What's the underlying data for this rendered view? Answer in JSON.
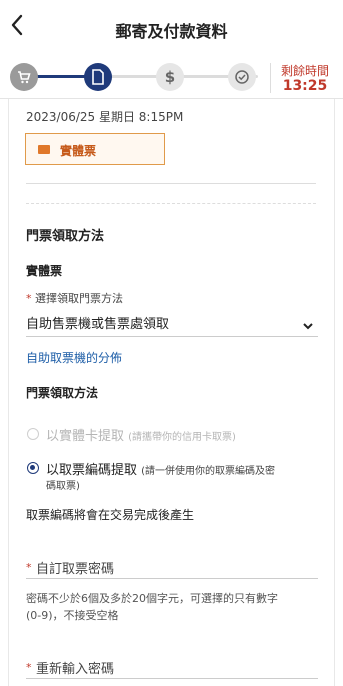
{
  "header": {
    "back_icon": "chevron-left-icon",
    "title": "郵寄及付款資料"
  },
  "steps": {
    "items": [
      {
        "icon": "cart-icon",
        "state": "done"
      },
      {
        "icon": "document-icon",
        "state": "active"
      },
      {
        "icon": "dollar-icon",
        "state": "pending"
      },
      {
        "icon": "check-icon",
        "state": "pending"
      }
    ],
    "colors": {
      "active": "#1f3a7a",
      "pending": "#d9d9d9"
    }
  },
  "timer": {
    "label": "剩餘時間",
    "value": "13:25",
    "color": "#c0392b"
  },
  "order": {
    "date": "2023/06/25 星期日 8:15PM",
    "ticket_type": "實體票"
  },
  "pickup": {
    "section_title": "門票領取方法",
    "subsection_title": "實體票",
    "select_label": "選擇領取門票方法",
    "select_value": "自助售票機或售票處領取",
    "kiosk_link": "自助取票機的分佈",
    "method_title": "門票領取方法",
    "option_card_label": "以實體卡提取",
    "option_card_hint": "(請攜帶你的信用卡取票)",
    "option_code_label": "以取票編碼提取",
    "option_code_hint_1": "(請一併使用你的取票編碼及密",
    "option_code_hint_2": "碼取票)",
    "note": "取票編碼將會在交易完成後產生"
  },
  "password": {
    "field_label": "自訂取票密碼",
    "rule_1": "密碼不少於6個及多於20個字元，可選擇的只有數字",
    "rule_2": "(0-9)，不接受空格",
    "confirm_label": "重新輸入密碼"
  },
  "required_mark": "*",
  "link_color": "#1f5fa8"
}
